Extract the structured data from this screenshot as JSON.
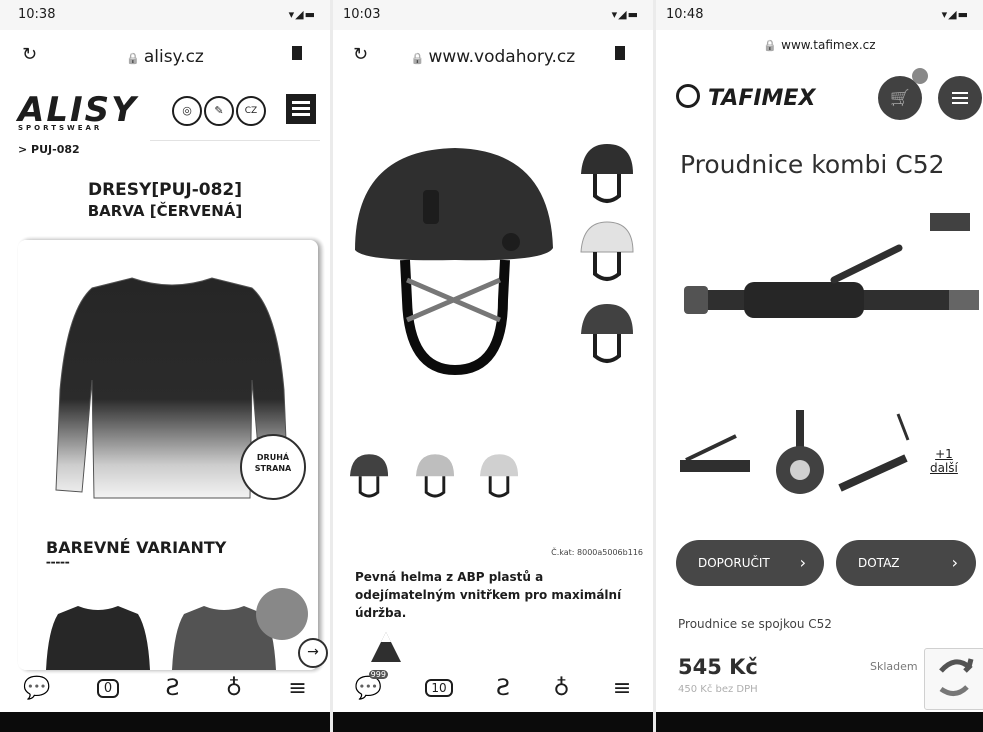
{
  "panel1": {
    "status_time": "10:38",
    "url": "alisy.cz",
    "logo": "ALISY",
    "logo_sub": "SPORTSWEAR",
    "lang": "CZ",
    "breadcrumb": "> PUJ-082",
    "title_line1": "DRESY[PUJ-082]",
    "title_line2": "BARVA [ČERVENÁ]",
    "badge_line1": "DRUHÁ",
    "badge_line2": "STRANA",
    "variants_title": "BAREVNÉ VARIANTY",
    "nav_count": "0"
  },
  "panel2": {
    "status_time": "10:03",
    "url": "www.vodahory.cz",
    "product_code": "Č.kat: 8000a5006b116",
    "description": "Pevná helma z ABP plastů a odejímatelným vnitřkem pro maximální údržba.",
    "nav_badge": "999",
    "nav_count": "10"
  },
  "panel3": {
    "status_time": "10:48",
    "url": "www.tafimex.cz",
    "logo": "TAFIMEX",
    "title": "Proudnice kombi C52",
    "more_count": "+1",
    "more_label": "další",
    "btn_recommend": "DOPORUČIT",
    "btn_query": "DOTAZ",
    "subtitle": "Proudnice se spojkou C52",
    "price": "545 Kč",
    "price_no_vat": "450 Kč bez DPH",
    "stock": "Skladem"
  }
}
